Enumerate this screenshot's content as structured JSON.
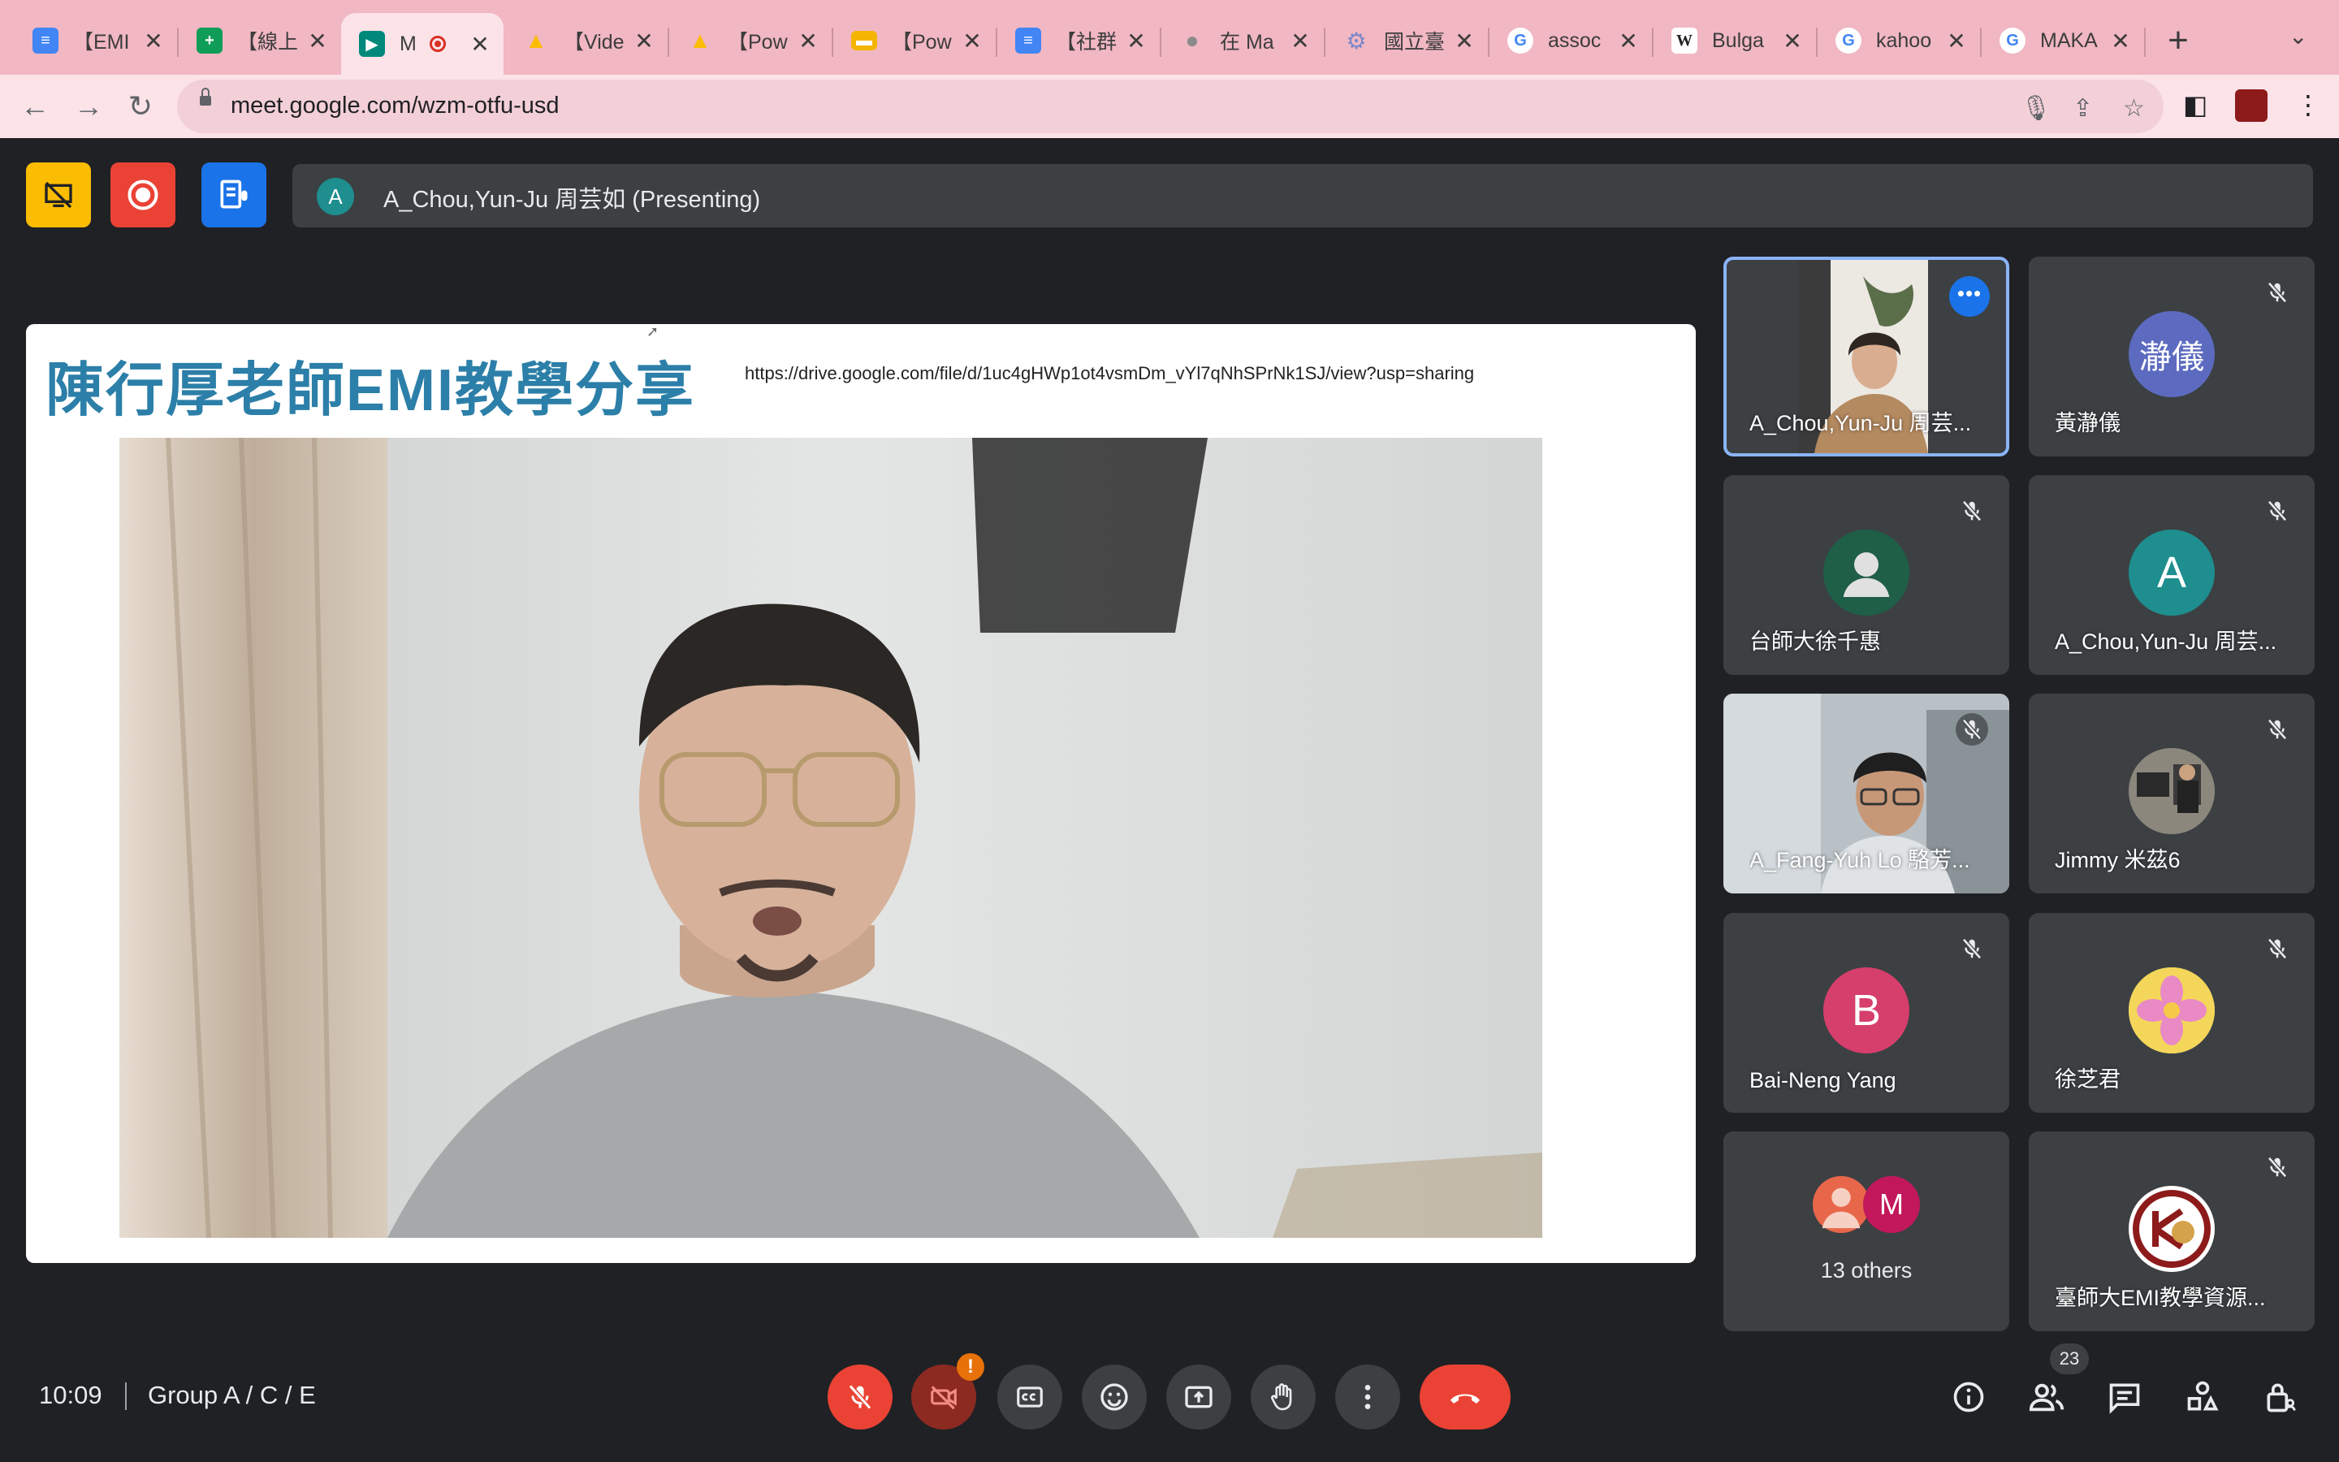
{
  "browser": {
    "tabs": [
      {
        "label": "【EMI",
        "color": "#4285f4",
        "glyph": "≡"
      },
      {
        "label": "【線上",
        "color": "#0f9d58",
        "glyph": "+"
      },
      {
        "label": "M",
        "color": "#00897b",
        "glyph": "▶"
      },
      {
        "label": "【Vide",
        "color": "#fbbc04",
        "glyph": "▲"
      },
      {
        "label": "【Pow",
        "color": "#fbbc04",
        "glyph": "▲"
      },
      {
        "label": "【Pow",
        "color": "#f4b400",
        "glyph": "▬"
      },
      {
        "label": "【社群",
        "color": "#4285f4",
        "glyph": "≡"
      },
      {
        "label": "在 Ma",
        "color": "#9aa0a6",
        "glyph": ""
      },
      {
        "label": "國立臺",
        "color": "#7986cb",
        "glyph": "⚙"
      },
      {
        "label": "assoc",
        "color": "#ffffff",
        "glyph": "G"
      },
      {
        "label": "Bulga",
        "color": "#ffffff",
        "glyph": "W"
      },
      {
        "label": "kahoo",
        "color": "#ffffff",
        "glyph": "G"
      },
      {
        "label": "MAKA",
        "color": "#ffffff",
        "glyph": "G"
      }
    ],
    "url": "meet.google.com/wzm-otfu-usd"
  },
  "meet": {
    "presenter_initial": "A",
    "presenting_text": "A_Chou,Yun-Ju 周芸如 (Presenting)",
    "slide": {
      "title": "陳行厚老師EMI教學分享",
      "url": "https://drive.google.com/file/d/1uc4gHWp1ot4vsmDm_vYl7qNhSPrNk1SJ/view?usp=sharing"
    },
    "tiles": [
      {
        "name": "A_Chou,Yun-Ju 周芸...",
        "initial": ""
      },
      {
        "name": "黃瀞儀",
        "initial": "瀞儀"
      },
      {
        "name": "台師大徐千惠",
        "initial": ""
      },
      {
        "name": "A_Chou,Yun-Ju 周芸...",
        "initial": "A"
      },
      {
        "name": "A_Fang-Yuh Lo 駱芳...",
        "initial": ""
      },
      {
        "name": "Jimmy 米茲6",
        "initial": ""
      },
      {
        "name": "Bai-Neng Yang",
        "initial": "B"
      },
      {
        "name": "徐芝君",
        "initial": ""
      },
      {
        "name": "臺師大EMI教學資源...",
        "initial": ""
      }
    ],
    "others": {
      "label": "13 others",
      "initial": "M"
    },
    "time": "10:09",
    "meeting_name": "Group A / C / E",
    "participant_count": "23",
    "colors": {
      "accent": "#8ab4f8",
      "hangup": "#ea4335",
      "tile_bg": "#3c4043",
      "bg": "#202124",
      "tab_bar": "#f1b7c3"
    }
  }
}
